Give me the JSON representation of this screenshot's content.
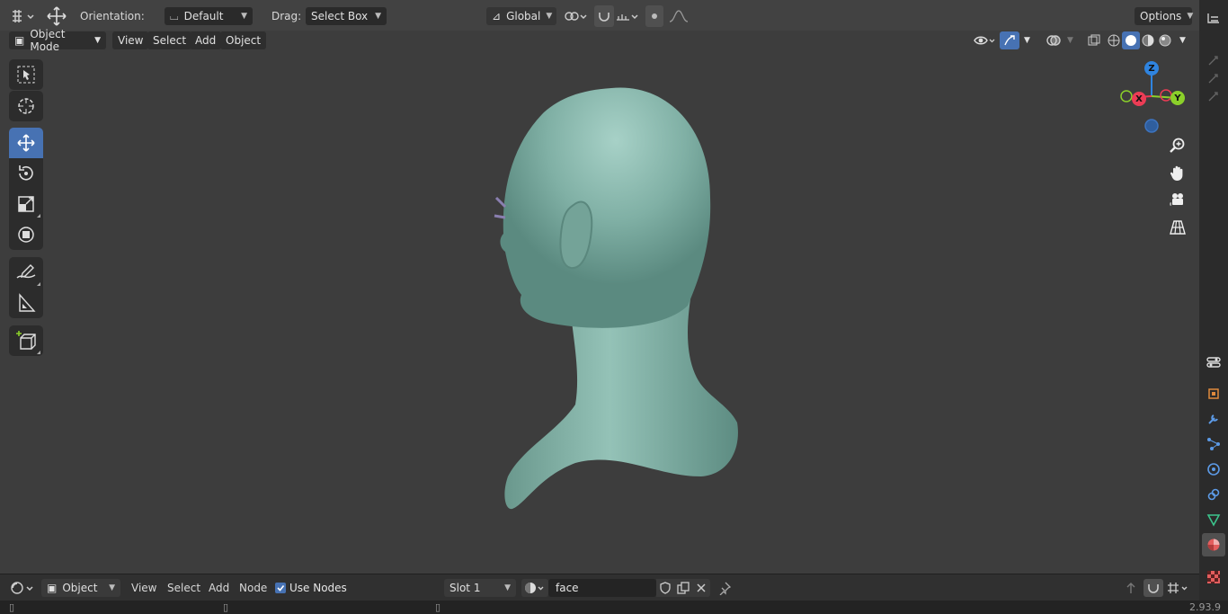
{
  "toolbar": {
    "orientation_label": "Orientation:",
    "orientation_value": "Default",
    "drag_label": "Drag:",
    "drag_value": "Select Box",
    "transform_orientation": "Global",
    "options_label": "Options"
  },
  "header": {
    "mode": "Object Mode",
    "menu": [
      "View",
      "Select",
      "Add",
      "Object"
    ]
  },
  "gizmo": {
    "z": "Z",
    "x": "X",
    "y": "Y"
  },
  "bottom": {
    "object_label": "Object",
    "menu": [
      "View",
      "Select",
      "Add",
      "Node"
    ],
    "use_nodes_label": "Use Nodes",
    "slot": "Slot 1",
    "material_name": "face"
  },
  "status": {
    "version": "2.93.9"
  },
  "colors": {
    "accent": "#4772b3",
    "mesh": "#84b3a8",
    "axis_x": "#ec3c55",
    "axis_y": "#8bd02a",
    "axis_z": "#2f84e0"
  }
}
